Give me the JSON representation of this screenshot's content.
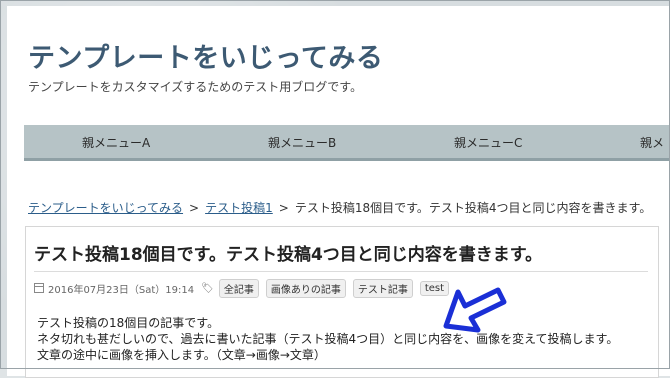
{
  "site": {
    "title": "テンプレートをいじってみる",
    "description": "テンプレートをカスタマイズするためのテスト用ブログです。"
  },
  "nav": {
    "items": [
      {
        "label": "親メニューA"
      },
      {
        "label": "親メニューB"
      },
      {
        "label": "親メニューC"
      },
      {
        "label": "親メ"
      }
    ]
  },
  "breadcrumb": {
    "home": "テンプレートをいじってみる",
    "separator": ">",
    "category": "テスト投稿1",
    "current": "テスト投稿18個目です。テスト投稿4つ目と同じ内容を書きます。"
  },
  "post": {
    "title": "テスト投稿18個目です。テスト投稿4つ目と同じ内容を書きます。",
    "date": "2016年07月23日（Sat）19:14",
    "tags": [
      "全記事",
      "画像ありの記事",
      "テスト記事",
      "test"
    ],
    "body": [
      "テスト投稿の18個目の記事です。",
      "ネタ切れも甚だしいので、過去に書いた記事（テスト投稿4つ目）と同じ内容を、画像を変えて投稿します。",
      "文章の途中に画像を挿入します。（文章→画像→文章）"
    ]
  },
  "colors": {
    "title": "#3d5a73",
    "nav_bg": "#b6c3c6",
    "arrow": "#1a2fd6"
  }
}
